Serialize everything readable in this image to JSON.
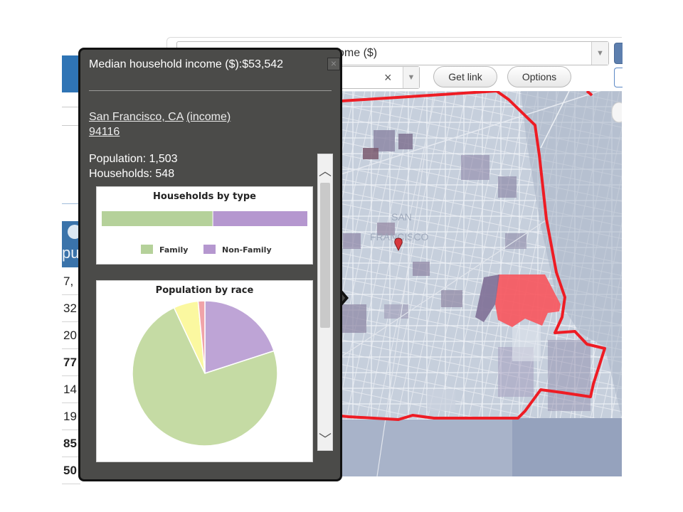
{
  "toolbar": {
    "variable_select_value": "ome ($)",
    "region_clear_glyph": "×",
    "dropdown_arrow_glyph": "▼",
    "get_link_label": "Get link",
    "options_label": "Options"
  },
  "left_panel": {
    "header_text": "pu",
    "cells": [
      "7,",
      "32",
      "20",
      "77",
      "14",
      "19",
      "85",
      "50"
    ]
  },
  "popup": {
    "title": "Median household income ($):$53,542",
    "close_glyph": "×",
    "place_name": "San Francisco, CA",
    "income_link": "(income)",
    "zip_code": "94116",
    "population_line": "Population: 1,503",
    "households_line": "Households: 548",
    "scroll_up_glyph": "︿",
    "scroll_down_glyph": "﹀"
  },
  "chart_data": [
    {
      "type": "bar",
      "title": "Households by type",
      "orientation": "horizontal-stacked",
      "series": [
        {
          "name": "Family",
          "color": "#b5d19a",
          "value": 0.54
        },
        {
          "name": "Non-Family",
          "color": "#b597cf",
          "value": 0.46
        }
      ],
      "legend_position": "bottom"
    },
    {
      "type": "pie",
      "title": "Population by race",
      "slices": [
        {
          "color": "#bea4d6",
          "value": 20
        },
        {
          "color": "#c5dba4",
          "value": 73
        },
        {
          "color": "#fbf8a0",
          "value": 5.5
        },
        {
          "color": "#f0a3a8",
          "value": 1.5
        }
      ]
    }
  ],
  "colors": {
    "popup_bg": "#4b4b49",
    "accent_blue": "#2f74b5",
    "map_boundary": "#ee1c24"
  }
}
